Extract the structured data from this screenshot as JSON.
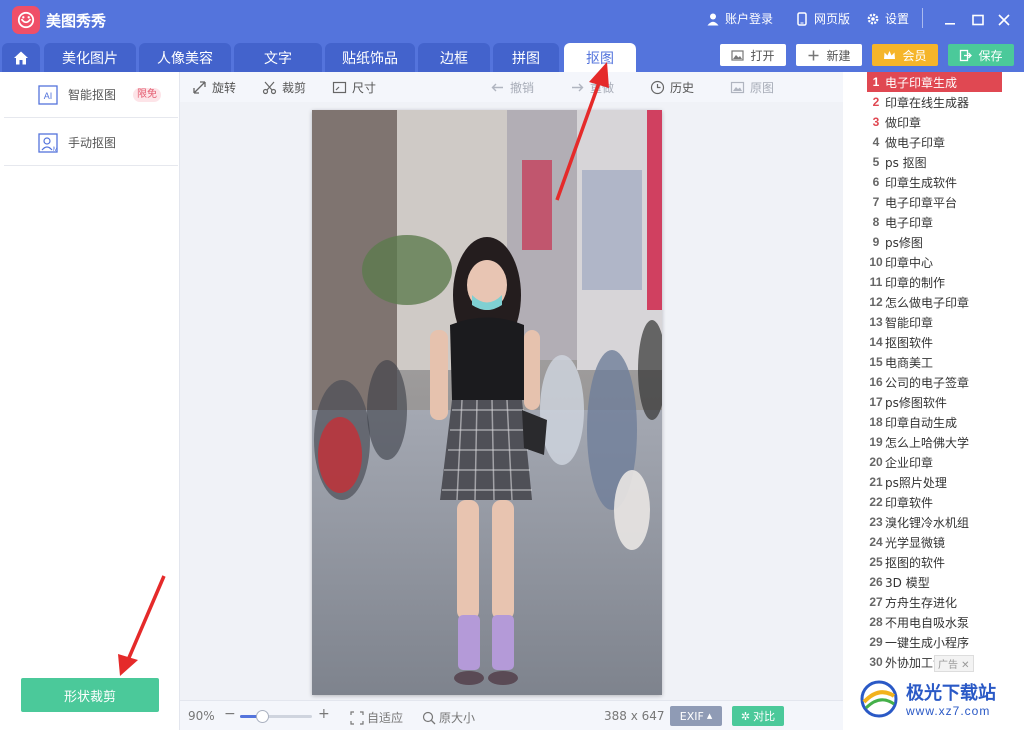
{
  "app": {
    "title": "美图秀秀",
    "account_label": "账户登录",
    "web_label": "网页版",
    "settings_label": "设置"
  },
  "tabs": [
    {
      "label": "美化图片"
    },
    {
      "label": "人像美容"
    },
    {
      "label": "文字"
    },
    {
      "label": "贴纸饰品"
    },
    {
      "label": "边框"
    },
    {
      "label": "拼图"
    },
    {
      "label": "抠图"
    }
  ],
  "actions": {
    "open": "打开",
    "new": "新建",
    "member": "会员",
    "save": "保存"
  },
  "left_panel": {
    "smart_cutout": "智能抠图",
    "smart_badge": "限免",
    "manual_cutout": "手动抠图",
    "shape_crop_button": "形状裁剪"
  },
  "toolbar": {
    "rotate": "旋转",
    "crop": "裁剪",
    "size": "尺寸",
    "undo": "撤销",
    "redo": "重做",
    "history": "历史",
    "original": "原图"
  },
  "bottom": {
    "zoom_level": "90%",
    "zoom_fraction": 0.3,
    "fit": "自适应",
    "original_size": "原大小",
    "dimensions": "388 x 647",
    "exif": "EXIF",
    "compare": "对比"
  },
  "ad_list": [
    {
      "num": "1",
      "label": "电子印章生成"
    },
    {
      "num": "2",
      "label": "印章在线生成器"
    },
    {
      "num": "3",
      "label": "做印章"
    },
    {
      "num": "4",
      "label": "做电子印章"
    },
    {
      "num": "5",
      "label": "ps 抠图"
    },
    {
      "num": "6",
      "label": "印章生成软件"
    },
    {
      "num": "7",
      "label": "电子印章平台"
    },
    {
      "num": "8",
      "label": "电子印章"
    },
    {
      "num": "9",
      "label": "ps修图"
    },
    {
      "num": "10",
      "label": "印章中心"
    },
    {
      "num": "11",
      "label": "印章的制作"
    },
    {
      "num": "12",
      "label": "怎么做电子印章"
    },
    {
      "num": "13",
      "label": "智能印章"
    },
    {
      "num": "14",
      "label": "抠图软件"
    },
    {
      "num": "15",
      "label": "电商美工"
    },
    {
      "num": "16",
      "label": "公司的电子签章"
    },
    {
      "num": "17",
      "label": "ps修图软件"
    },
    {
      "num": "18",
      "label": "印章自动生成"
    },
    {
      "num": "19",
      "label": "怎么上哈佛大学"
    },
    {
      "num": "20",
      "label": "企业印章"
    },
    {
      "num": "21",
      "label": "ps照片处理"
    },
    {
      "num": "22",
      "label": "印章软件"
    },
    {
      "num": "23",
      "label": "溴化锂冷水机组"
    },
    {
      "num": "24",
      "label": "光学显微镜"
    },
    {
      "num": "25",
      "label": "抠图的软件"
    },
    {
      "num": "26",
      "label": "3D 模型"
    },
    {
      "num": "27",
      "label": "方舟生存进化"
    },
    {
      "num": "28",
      "label": "不用电自吸水泵"
    },
    {
      "num": "29",
      "label": "一键生成小程序"
    },
    {
      "num": "30",
      "label": "外协加工订单"
    }
  ],
  "ad_tag": "广告 ✕",
  "watermark": {
    "name": "极光下载站",
    "url": "www.xz7.com"
  },
  "colors": {
    "brand": "#5474dc",
    "accent_green": "#4bc99a",
    "ad_highlight": "#e04852",
    "member_gold": "#f5b52a"
  }
}
